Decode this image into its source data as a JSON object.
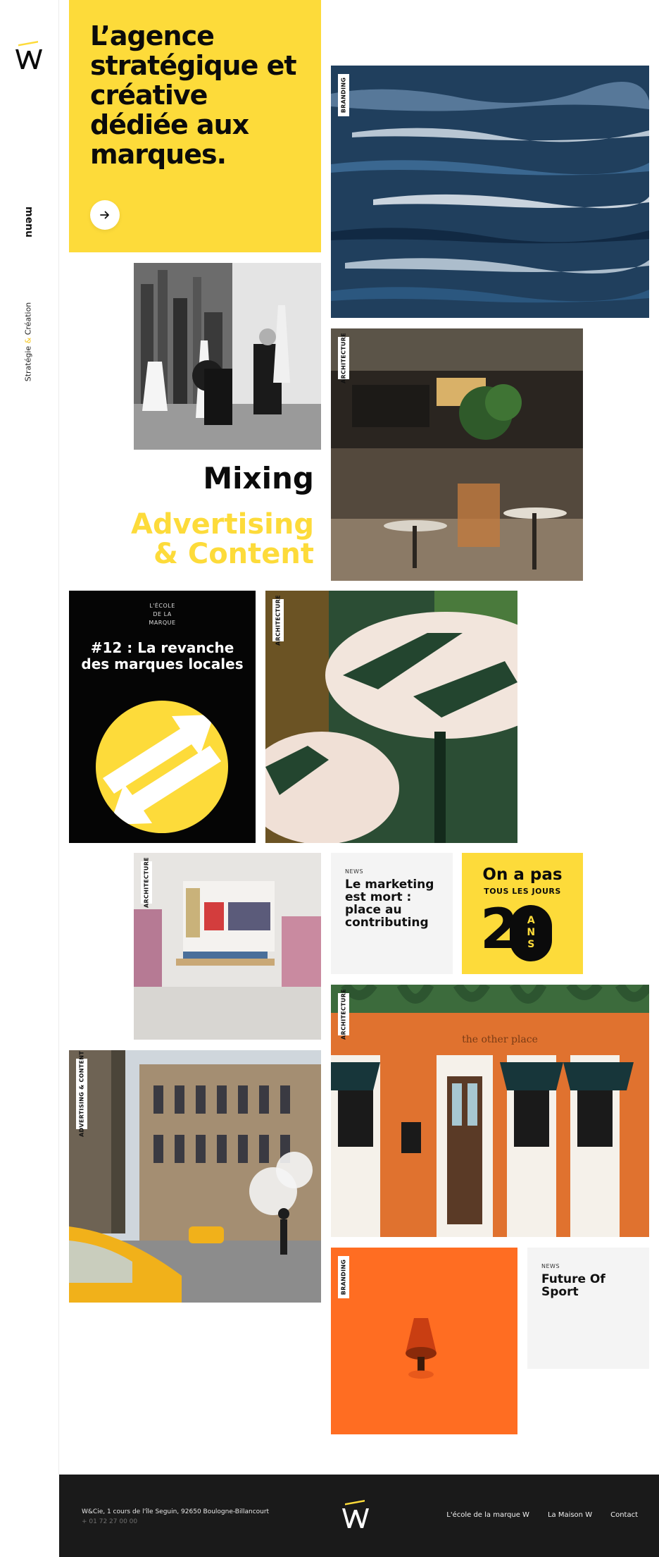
{
  "sidebar": {
    "menu_label": "menu",
    "tagline_part1": "Stratégie",
    "tagline_amp": "&",
    "tagline_part2": "Création"
  },
  "hero": {
    "title": "L’agence stratégique et créative dédiée aux marques.",
    "cta_icon": "arrow-right-icon"
  },
  "tiles": {
    "sea_label": "BRANDING",
    "cafe_label": "ARCHITECTURE",
    "table_label": "ARCHITECTURE",
    "shop_label": "ARCHITECTURE",
    "storefront_label": "ARCHITECTURE",
    "nyc_label": "ADVERTISING & CONTENT",
    "orange_label": "BRANDING"
  },
  "mixing": {
    "line1": "Mixing",
    "line2": "Advertising",
    "line3": "& Content"
  },
  "podcast": {
    "ecole_line1": "L'ÉCOLE",
    "ecole_line2": "DE LA",
    "ecole_line3": "MARQUE",
    "title": "#12 : La revanche des marques locales"
  },
  "news": [
    {
      "kicker": "NEWS",
      "title": "Le marketing est mort : place au contributing"
    },
    {
      "kicker": "NEWS",
      "title": "Future Of Sport"
    }
  ],
  "anniversary": {
    "line1": "On a pas",
    "line2": "TOUS LES JOURS",
    "digit2": "2",
    "ans": "ANS"
  },
  "storefront": {
    "sign": "the other place"
  },
  "footer": {
    "address": "W&Cie, 1 cours de l'île Seguin, 92650 Boulogne-Billancourt",
    "phone": "+ 01 72 27 00 00",
    "links": [
      "L'école de la marque W",
      "La Maison W",
      "Contact"
    ]
  },
  "colors": {
    "yellow": "#fddb3a",
    "black": "#0b0b0b",
    "orange": "#ff6d22",
    "footer_bg": "#1a1a1a"
  }
}
